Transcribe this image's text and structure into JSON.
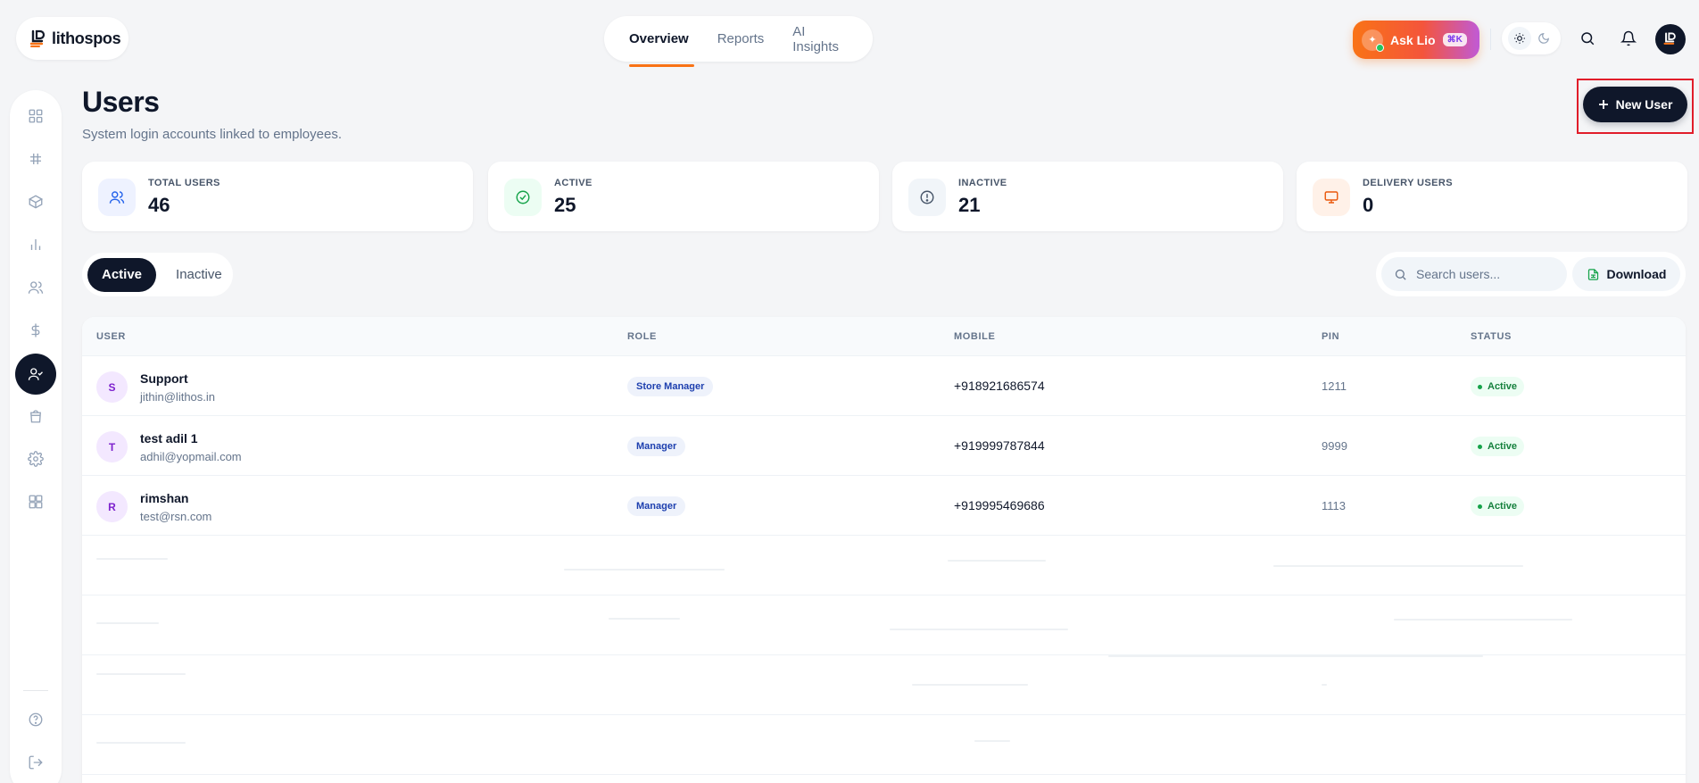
{
  "brand": {
    "name": "lithospos"
  },
  "topnav": {
    "tabs": [
      "Overview",
      "Reports",
      "AI Insights"
    ],
    "active_index": 0
  },
  "ask": {
    "label": "Ask Lio",
    "shortcut": "⌘K"
  },
  "colors": {
    "accent": "#f97316",
    "dark": "#0f172a",
    "highlight": "#e11d2a"
  },
  "page": {
    "title": "Users",
    "subtitle": "System login accounts linked to employees.",
    "new_button": "New User"
  },
  "stats": [
    {
      "label": "TOTAL USERS",
      "value": "46",
      "icon": "users-icon"
    },
    {
      "label": "ACTIVE",
      "value": "25",
      "icon": "check-circle-icon"
    },
    {
      "label": "INACTIVE",
      "value": "21",
      "icon": "alert-circle-icon"
    },
    {
      "label": "DELIVERY USERS",
      "value": "0",
      "icon": "monitor-icon"
    }
  ],
  "filter": {
    "options": [
      "Active",
      "Inactive"
    ],
    "selected": "Active"
  },
  "search": {
    "placeholder": "Search users..."
  },
  "download_label": "Download",
  "table": {
    "columns": [
      "USER",
      "ROLE",
      "MOBILE",
      "PIN",
      "STATUS"
    ],
    "rows": [
      {
        "initial": "S",
        "name": "Support",
        "email": "jithin@lithos.in",
        "role": "Store Manager",
        "mobile": "+918921686574",
        "pin": "1211",
        "status": "Active"
      },
      {
        "initial": "T",
        "name": "test adil 1",
        "email": "adhil@yopmail.com",
        "role": "Manager",
        "mobile": "+919999787844",
        "pin": "9999",
        "status": "Active"
      },
      {
        "initial": "R",
        "name": "rimshan",
        "email": "test@rsn.com",
        "role": "Manager",
        "mobile": "+919995469686",
        "pin": "1113",
        "status": "Active"
      }
    ]
  }
}
